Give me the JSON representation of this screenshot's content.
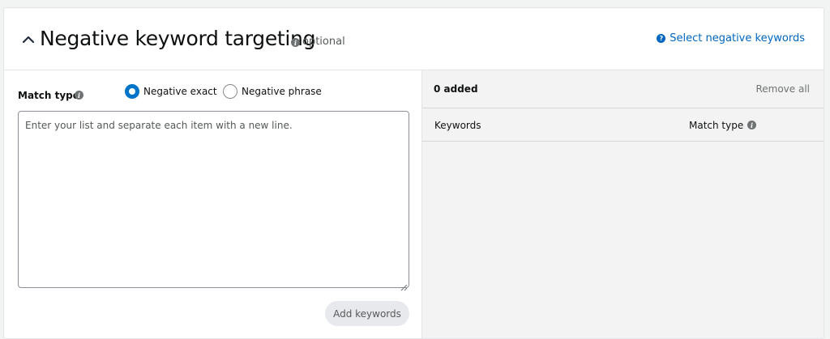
{
  "section": {
    "title": "Negative keyword targeting",
    "optional_label": "optional",
    "help_link": "Select negative keywords"
  },
  "left": {
    "match_type_label": "Match type",
    "radios": [
      {
        "label": "Negative exact",
        "checked": true
      },
      {
        "label": "Negative phrase",
        "checked": false
      }
    ],
    "textarea_placeholder": "Enter your list and separate each item with a new line.",
    "textarea_value": "",
    "add_button": "Add keywords"
  },
  "right": {
    "added_count": "0 added",
    "remove_all": "Remove all",
    "columns": [
      "Keywords",
      "Match type"
    ]
  },
  "colors": {
    "accent": "#0074c8",
    "link": "#0066c0",
    "panel_bg": "#ffffff",
    "right_bg": "#f3f3f3"
  },
  "icons": {
    "collapse": "chevron-up-icon",
    "info": "info-icon",
    "help": "question-circle-icon"
  }
}
